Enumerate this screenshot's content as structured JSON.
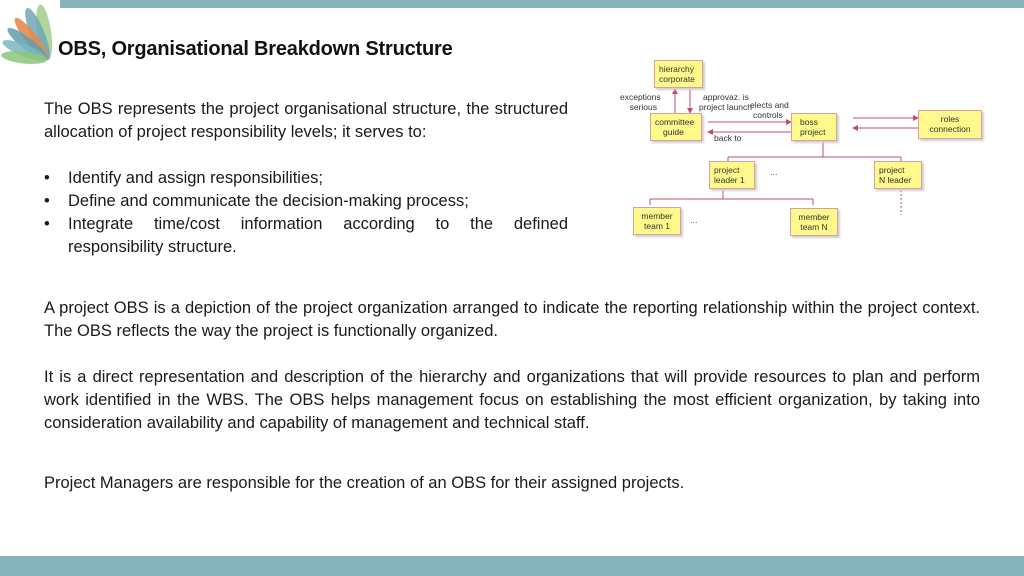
{
  "title": "OBS, Organisational Breakdown Structure",
  "intro": "The OBS represents the project organisational structure, the structured allocation of project responsibility levels; it serves to:",
  "bullets": [
    "Identify and assign responsibilities;",
    "Define and communicate the decision-making process;",
    "Integrate time/cost information according to the defined responsibility structure."
  ],
  "bullet_glyph": "•",
  "paragraphs": [
    "A project OBS is a depiction of the project organization arranged to indicate the reporting relationship within the project context. The OBS reflects the way the project is functionally organized.",
    "It is a direct representation and description of the hierarchy and organizations that will provide resources to plan and perform work identified in the WBS. The OBS helps management focus on establishing the most efficient organization, by taking into consideration availability and capability of management and technical staff.",
    "Project Managers are responsible for the creation of an OBS for their assigned projects."
  ],
  "diagram": {
    "nodes": {
      "hierarchy": [
        "hierarchy",
        "corporate"
      ],
      "committee": [
        "committee",
        "guide"
      ],
      "boss": [
        "boss",
        "project"
      ],
      "roles": [
        "roles",
        "connection"
      ],
      "leader1": [
        "project",
        "leader 1"
      ],
      "leaderN": [
        "project",
        "N leader"
      ],
      "member1": [
        "member",
        "team 1"
      ],
      "memberN": [
        "member",
        "team N"
      ]
    },
    "labels": {
      "exceptions": [
        "exceptions",
        "serious"
      ],
      "approvaz": [
        "approvaz. is",
        "project launch"
      ],
      "elects": [
        "elects and",
        "controls"
      ],
      "backto": "back to",
      "ellipsis": "..."
    },
    "colors": {
      "node_fill": "#fff98c",
      "line": "#c0506a"
    }
  },
  "theme": {
    "accent_bar": "#86b4ba"
  }
}
